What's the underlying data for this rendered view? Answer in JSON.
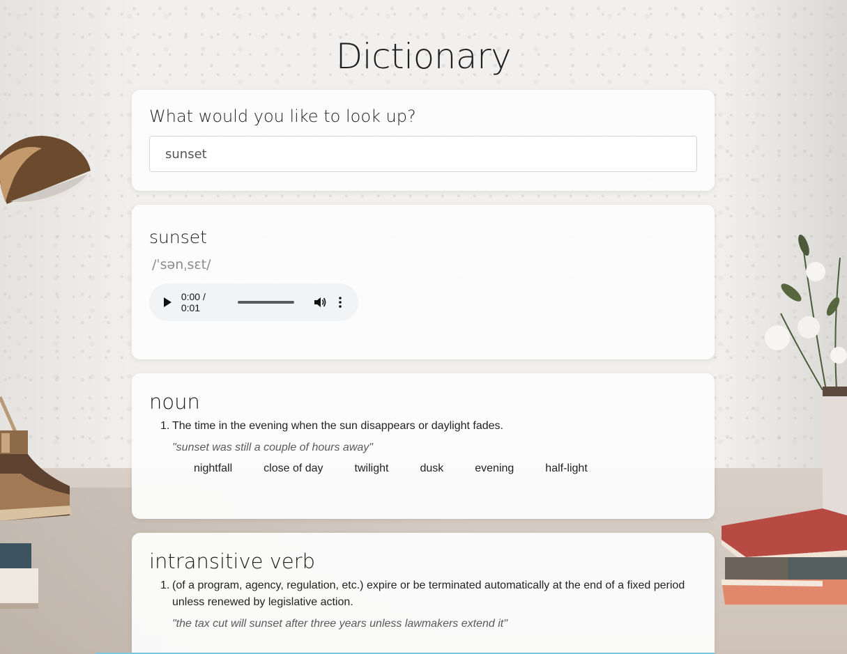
{
  "app": {
    "title": "Dictionary"
  },
  "search": {
    "prompt": "What would you like to look up?",
    "value": "sunset"
  },
  "result": {
    "word": "sunset",
    "phonetic": "/ˈsənˌsɛt/",
    "audio": {
      "time": "0:00 / 0:01",
      "progress": 0
    }
  },
  "meanings": [
    {
      "part_of_speech": "noun",
      "definitions": [
        {
          "number": "1.",
          "text": "The time in the evening when the sun disappears or daylight fades.",
          "example": "\"sunset was still a couple of hours away\""
        }
      ],
      "synonyms": [
        "nightfall",
        "close of day",
        "twilight",
        "dusk",
        "evening",
        "half-light"
      ]
    },
    {
      "part_of_speech": "intransitive verb",
      "definitions": [
        {
          "number": "1.",
          "text": "(of a program, agency, regulation, etc.) expire or be terminated automatically at the end of a fixed period unless renewed by legislative action.",
          "example": "\"the tax cut will sunset after three years unless lawmakers extend it\""
        }
      ]
    }
  ],
  "icons": {
    "play": "play-icon",
    "volume": "volume-icon",
    "more": "more-vertical-icon"
  }
}
